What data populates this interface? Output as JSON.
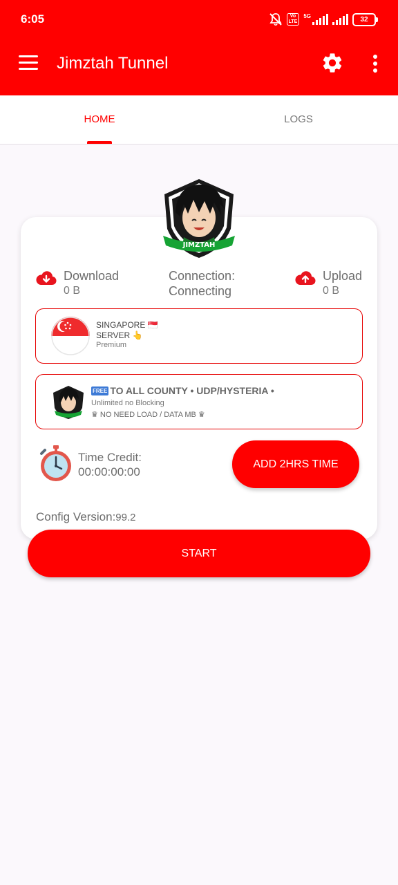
{
  "status_bar": {
    "time": "6:05",
    "network": "5G",
    "volte": "Vo LTE",
    "battery": "32"
  },
  "app_bar": {
    "title": "Jimztah Tunnel",
    "icons": [
      "menu-icon",
      "gear-icon",
      "more-vert-icon"
    ]
  },
  "tabs": [
    {
      "label": "HOME",
      "active": true
    },
    {
      "label": "LOGS",
      "active": false
    }
  ],
  "logo": {
    "text": "JIMZTAH"
  },
  "stats": {
    "download": {
      "label": "Download",
      "value": "0 B"
    },
    "connection": {
      "label": "Connection:",
      "value": "Connecting"
    },
    "upload": {
      "label": "Upload",
      "value": "0 B"
    }
  },
  "server": {
    "name_line1": "SINGAPORE 🇸🇬",
    "name_line2": "SERVER 👆",
    "tier": "Premium"
  },
  "network_config": {
    "badge": "FREE",
    "title": "TO ALL COUNTY • UDP/HYSTERIA •",
    "line1": "Unlimited no Blocking",
    "line2": "♛ NO NEED LOAD / DATA MB ♛"
  },
  "time_credit": {
    "label": "Time Credit:",
    "value": "00:00:00:00"
  },
  "buttons": {
    "add_time": "ADD 2HRS TIME",
    "start": "START"
  },
  "config": {
    "label": "Config Version:",
    "version": "99.2"
  },
  "colors": {
    "primary": "#ff0000",
    "background": "#fbf8fc",
    "text_gray": "#6d6d6d"
  }
}
